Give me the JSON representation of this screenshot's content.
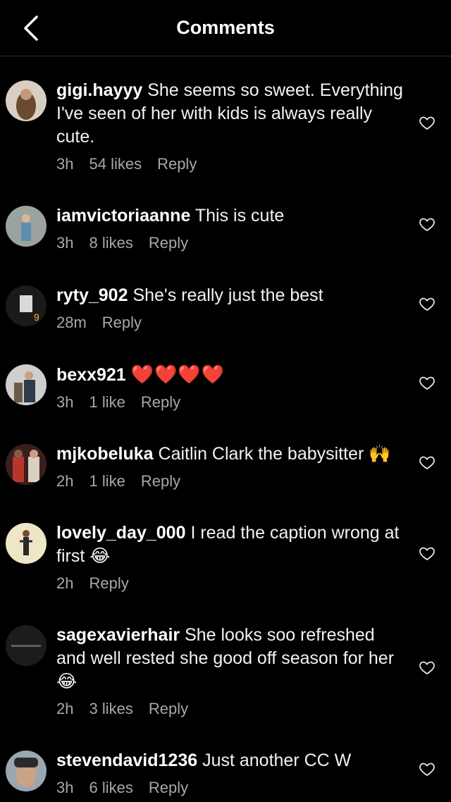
{
  "header": {
    "title": "Comments"
  },
  "comments": [
    {
      "username": "gigi.hayyy",
      "text": "She seems so sweet. Everything I've seen of her with kids is always really cute.",
      "time": "3h",
      "likes": "54 likes",
      "reply": "Reply"
    },
    {
      "username": "iamvictoriaanne",
      "text": "This is cute",
      "time": "3h",
      "likes": "8 likes",
      "reply": "Reply"
    },
    {
      "username": "ryty_902",
      "text": "She's really just the best",
      "time": "28m",
      "likes": "",
      "reply": "Reply"
    },
    {
      "username": "bexx921",
      "text": "❤️❤️❤️❤️",
      "time": "3h",
      "likes": "1 like",
      "reply": "Reply"
    },
    {
      "username": "mjkobeluka",
      "text": "Caitlin Clark the babysitter 🙌",
      "time": "2h",
      "likes": "1 like",
      "reply": "Reply"
    },
    {
      "username": "lovely_day_000",
      "text": "I read the caption wrong at first 😂",
      "time": "2h",
      "likes": "",
      "reply": "Reply"
    },
    {
      "username": "sagexavierhair",
      "text": "She looks soo refreshed and well rested she good off season for her 😂",
      "time": "2h",
      "likes": "3 likes",
      "reply": "Reply"
    },
    {
      "username": "stevendavid1236",
      "text": "Just another CC W",
      "time": "3h",
      "likes": "6 likes",
      "reply": "Reply"
    }
  ],
  "icons": {
    "back": "chevron-left-icon",
    "like": "heart-outline-icon"
  },
  "colors": {
    "background": "#000000",
    "text": "#f2f2f2",
    "meta": "#a8a8a8",
    "divider": "#2e2e2e"
  }
}
